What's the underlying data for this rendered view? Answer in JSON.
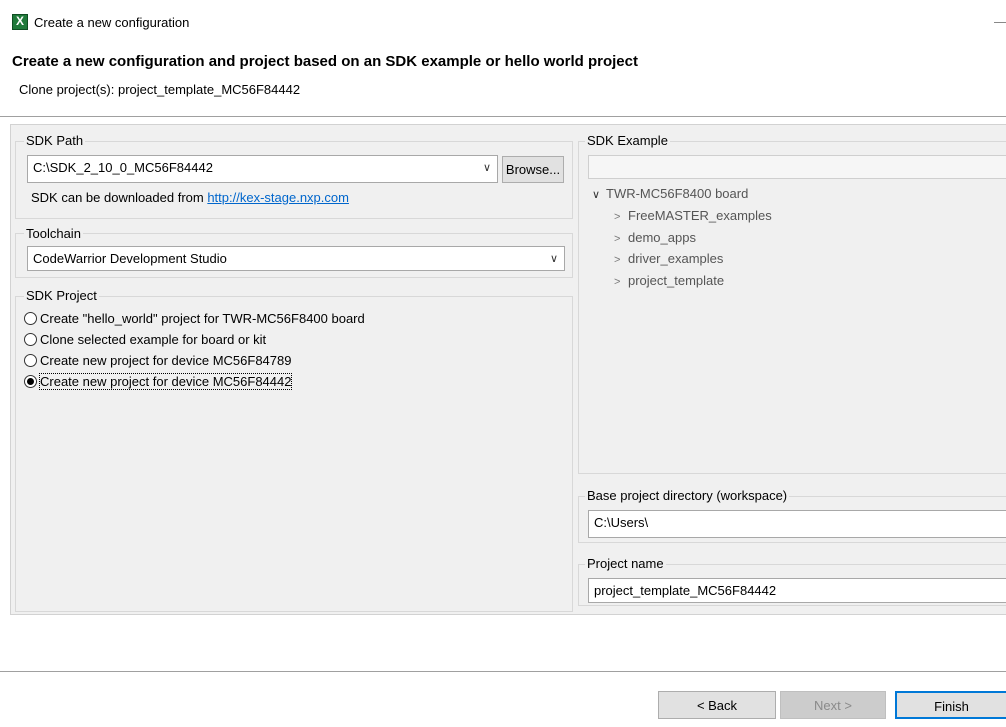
{
  "window": {
    "title": "Create a new configuration",
    "dash": "—"
  },
  "header": {
    "title": "Create a new configuration and project based on an SDK example or hello world project",
    "subtitle": "Clone project(s): project_template_MC56F84442"
  },
  "sdk_path": {
    "legend": "SDK Path",
    "value": "C:\\SDK_2_10_0_MC56F84442",
    "browse_label": "Browse...",
    "download_text": "SDK can be downloaded from ",
    "download_link": "http://kex-stage.nxp.com"
  },
  "toolchain": {
    "legend": "Toolchain",
    "value": "CodeWarrior Development Studio"
  },
  "sdk_project": {
    "legend": "SDK Project",
    "options": [
      {
        "label": "Create \"hello_world\" project for TWR-MC56F8400 board",
        "checked": false
      },
      {
        "label": "Clone selected example for board or kit",
        "checked": false
      },
      {
        "label": "Create new project for device MC56F84789",
        "checked": false
      },
      {
        "label": "Create new project for device MC56F84442",
        "checked": true
      }
    ]
  },
  "sdk_example": {
    "legend": "SDK Example",
    "filter_value": "",
    "tree": {
      "root": "TWR-MC56F8400 board",
      "children": [
        "FreeMASTER_examples",
        "demo_apps",
        "driver_examples",
        "project_template"
      ]
    }
  },
  "base_dir": {
    "legend": "Base project directory (workspace)",
    "value": "C:\\Users\\"
  },
  "project_name": {
    "legend": "Project name",
    "value": "project_template_MC56F84442"
  },
  "buttons": {
    "back": "< Back",
    "next": "Next >",
    "finish": "Finish"
  },
  "colors": {
    "link": "#0066cc",
    "panel": "#f0f0f0",
    "accent_border": "#0078d7"
  }
}
